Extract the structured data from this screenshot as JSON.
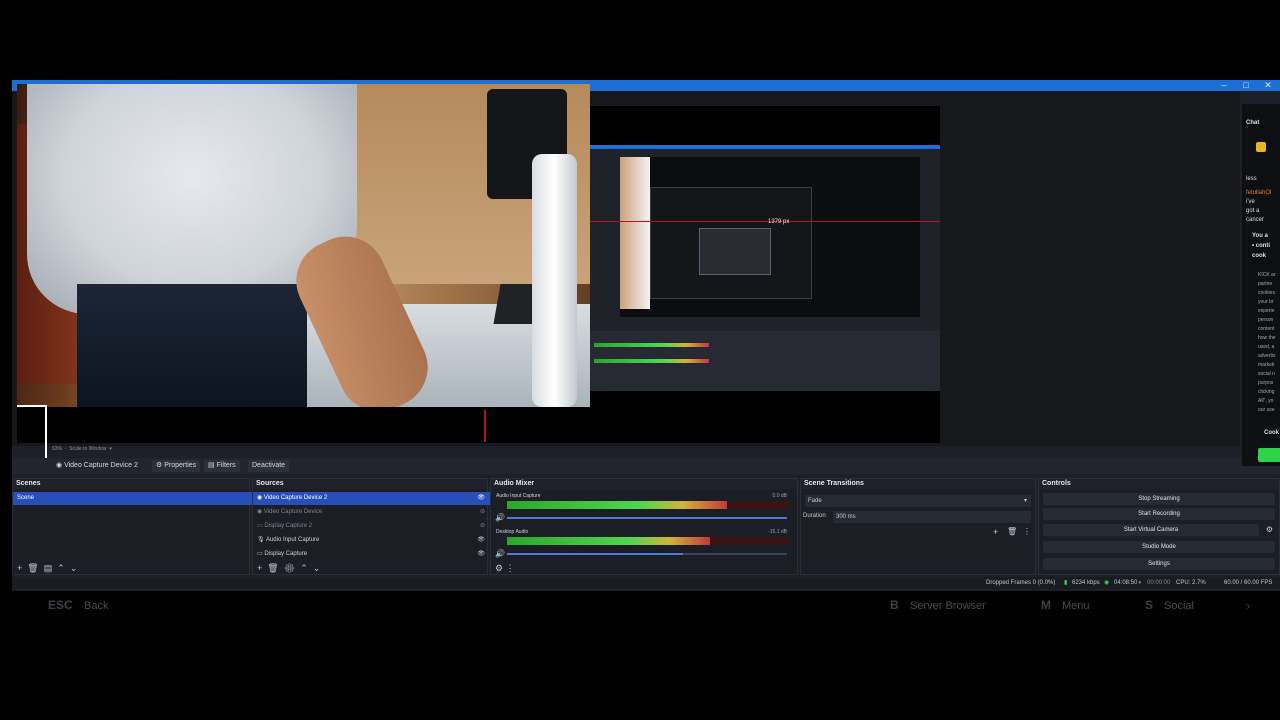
{
  "window": {
    "title_minimize": "–",
    "title_maximize": "□",
    "title_close": "✕"
  },
  "preview": {
    "measure_label": "1379 px",
    "scale_zoom": "63%",
    "scale_mode": "Scale to Window"
  },
  "source_toolbar": {
    "selected_source": "Video Capture Device 2",
    "properties_label": "Properties",
    "filters_label": "Filters",
    "deactivate_label": "Deactivate"
  },
  "scenes": {
    "header": "Scenes",
    "items": [
      "Scene"
    ]
  },
  "sources": {
    "header": "Sources",
    "items": [
      {
        "label": "Video Capture Device 2"
      },
      {
        "label": "Video Capture Device"
      },
      {
        "label": "Display Capture 2"
      },
      {
        "label": "Audio Input Capture"
      },
      {
        "label": "Display Capture"
      }
    ]
  },
  "audio_mixer": {
    "header": "Audio Mixer",
    "channels": [
      {
        "name": "Audio Input Capture",
        "db": "0.0 dB",
        "level": 0.78,
        "volume": 1.0
      },
      {
        "name": "Desktop Audio",
        "db": "-15.1 dB",
        "level": 0.72,
        "volume": 0.63
      }
    ],
    "ticks": [
      "-60",
      "-55",
      "-50",
      "-45",
      "-40",
      "-35",
      "-30",
      "-25",
      "-20",
      "-15",
      "-10",
      "-5",
      "0"
    ]
  },
  "transitions": {
    "header": "Scene Transitions",
    "selected": "Fade",
    "duration_label": "Duration",
    "duration_value": "300 ms"
  },
  "controls": {
    "header": "Controls",
    "buttons": [
      "Stop Streaming",
      "Start Recording",
      "Start Virtual Camera",
      "Studio Mode",
      "Settings"
    ]
  },
  "status": {
    "dropped_frames": "Dropped Frames 0 (0.0%)",
    "bitrate": "6234 kbps",
    "stream_time": "04:08:50",
    "rec_time": "00:00:00",
    "cpu": "CPU: 2.7%",
    "fps": "60.00 / 60.00 FPS"
  },
  "chat": {
    "title": "Chat",
    "lines": [
      "less",
      "fetullahOl",
      "i've",
      "got a",
      "cancer",
      "You a",
      "• conti",
      "cook",
      "KICK ar",
      "partne",
      "cookies",
      "your br",
      "experie",
      "person",
      "content",
      "how the",
      "used, a",
      "advertis",
      "marketi",
      "social n",
      "purpos",
      "clicking",
      "All\", yo",
      "our use",
      "Cook"
    ]
  },
  "bottom_bar": {
    "esc_key": "ESC",
    "back_label": "Back",
    "b_key": "B",
    "server_browser_label": "Server Browser",
    "m_key": "M",
    "menu_label": "Menu",
    "s_key": "S",
    "social_label": "Social"
  }
}
